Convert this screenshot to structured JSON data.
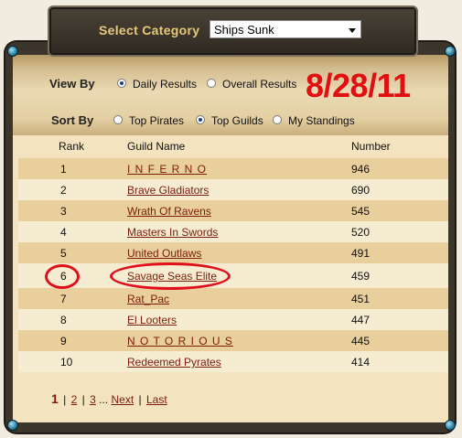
{
  "category": {
    "label": "Select Category",
    "selected": "Ships Sunk"
  },
  "view_by": {
    "label": "View By",
    "options": [
      {
        "label": "Daily Results",
        "selected": true
      },
      {
        "label": "Overall Results",
        "selected": false
      }
    ]
  },
  "date_stamp": "8/28/11",
  "sort_by": {
    "label": "Sort By",
    "options": [
      {
        "label": "Top Pirates",
        "selected": false
      },
      {
        "label": "Top Guilds",
        "selected": true
      },
      {
        "label": "My Standings",
        "selected": false
      }
    ]
  },
  "table": {
    "headers": {
      "rank": "Rank",
      "guild": "Guild Name",
      "number": "Number"
    },
    "rows": [
      {
        "rank": "1",
        "guild": "I N F E R N O",
        "number": "946"
      },
      {
        "rank": "2",
        "guild": "Brave Gladiators",
        "number": "690"
      },
      {
        "rank": "3",
        "guild": "Wrath Of Ravens",
        "number": "545"
      },
      {
        "rank": "4",
        "guild": "Masters In Swords",
        "number": "520"
      },
      {
        "rank": "5",
        "guild": "United Outlaws",
        "number": "491"
      },
      {
        "rank": "6",
        "guild": "Savage Seas Elite",
        "number": "459"
      },
      {
        "rank": "7",
        "guild": "Rat_Pac",
        "number": "451"
      },
      {
        "rank": "8",
        "guild": "El Looters",
        "number": "447"
      },
      {
        "rank": "9",
        "guild": "N O T O R I O U S",
        "number": "445"
      },
      {
        "rank": "10",
        "guild": "Redeemed Pyrates",
        "number": "414"
      }
    ]
  },
  "pager": {
    "current": "1",
    "pages": [
      "2",
      "3"
    ],
    "ellipsis": "...",
    "next": "Next",
    "last": "Last"
  },
  "colors": {
    "highlight": "#e0101b",
    "link": "#7a1b0c",
    "radio_selected": "#1a3f8f"
  }
}
